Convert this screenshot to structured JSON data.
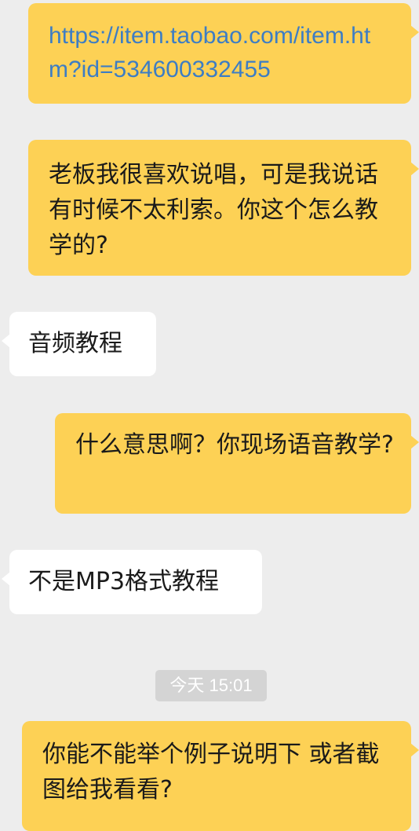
{
  "chat": {
    "messages": [
      {
        "direction": "out",
        "kind": "link",
        "text": "https://item.taobao.com/item.htm?id=534600332455"
      },
      {
        "direction": "out",
        "kind": "text",
        "text": "老板我很喜欢说唱，可是我说话有时候不太利索。你这个怎么教学的?"
      },
      {
        "direction": "in",
        "kind": "text",
        "text": "音频教程"
      },
      {
        "direction": "out",
        "kind": "text",
        "text": "什么意思啊？你现场语音教学?"
      },
      {
        "direction": "in",
        "kind": "text",
        "text": "不是MP3格式教程"
      },
      {
        "direction": "out",
        "kind": "text",
        "text": "你能不能举个例子说明下 或者截图给我看看?"
      }
    ],
    "timestamp": "今天 15:01"
  },
  "colors": {
    "background": "#ededed",
    "outgoing_bubble": "#fdd155",
    "incoming_bubble": "#ffffff",
    "link": "#3d7dc4",
    "timestamp_pill": "#d4d4d4"
  }
}
